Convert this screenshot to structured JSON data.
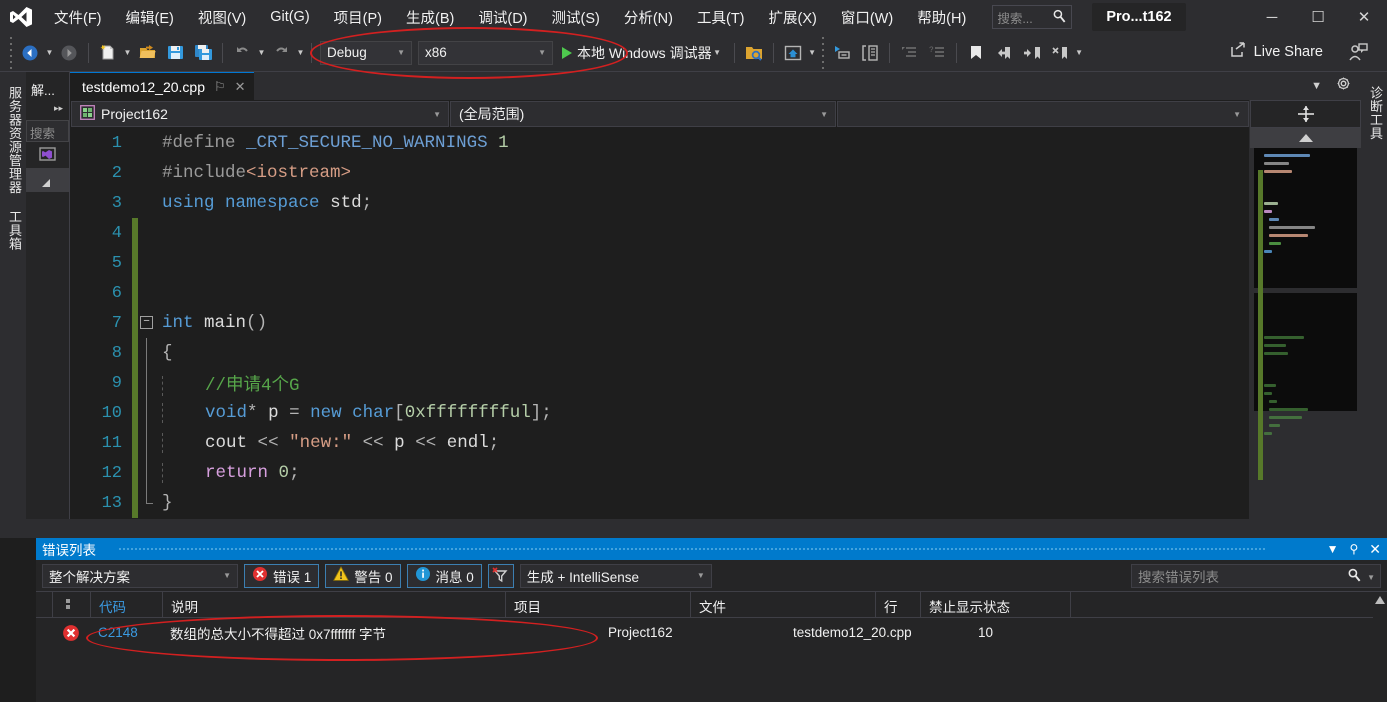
{
  "window": {
    "project_badge": "Pro...t162",
    "minimize": "─",
    "maximize": "☐",
    "close": "✕"
  },
  "menu": {
    "items": [
      {
        "label": "文件(F)",
        "name": "menu-file"
      },
      {
        "label": "编辑(E)",
        "name": "menu-edit"
      },
      {
        "label": "视图(V)",
        "name": "menu-view"
      },
      {
        "label": "Git(G)",
        "name": "menu-git"
      },
      {
        "label": "项目(P)",
        "name": "menu-project"
      },
      {
        "label": "生成(B)",
        "name": "menu-build"
      },
      {
        "label": "调试(D)",
        "name": "menu-debug"
      },
      {
        "label": "测试(S)",
        "name": "menu-test"
      },
      {
        "label": "分析(N)",
        "name": "menu-analyze"
      },
      {
        "label": "工具(T)",
        "name": "menu-tools"
      },
      {
        "label": "扩展(X)",
        "name": "menu-extensions"
      },
      {
        "label": "窗口(W)",
        "name": "menu-window"
      },
      {
        "label": "帮助(H)",
        "name": "menu-help"
      }
    ],
    "search_placeholder": "搜索..."
  },
  "toolbar": {
    "configuration": "Debug",
    "platform": "x86",
    "run_label": "本地 Windows 调试器",
    "live_share": "Live Share"
  },
  "left_dock": {
    "server_explorer": "服务器资源管理器",
    "toolbox": "工具箱"
  },
  "right_dock": {
    "diagnostic_tools": "诊断工具"
  },
  "solution_explorer": {
    "title": "解...",
    "search_placeholder": "搜索"
  },
  "editor": {
    "tab_name": "testdemo12_20.cpp",
    "pin_glyph": "⚐",
    "close_glyph": "✕",
    "nav_project": "Project162",
    "nav_scope": "(全局范围)",
    "lines": [
      {
        "n": "1",
        "changed": false,
        "fold": "none",
        "text": "#define _CRT_SECURE_NO_WARNINGS 1"
      },
      {
        "n": "2",
        "changed": false,
        "fold": "none",
        "text": "#include<iostream>"
      },
      {
        "n": "3",
        "changed": false,
        "fold": "none",
        "text": "using namespace std;"
      },
      {
        "n": "4",
        "changed": true,
        "fold": "none",
        "text": ""
      },
      {
        "n": "5",
        "changed": true,
        "fold": "none",
        "text": ""
      },
      {
        "n": "6",
        "changed": true,
        "fold": "none",
        "text": ""
      },
      {
        "n": "7",
        "changed": true,
        "fold": "minus",
        "text": "int main()"
      },
      {
        "n": "8",
        "changed": true,
        "fold": "line",
        "text": "{"
      },
      {
        "n": "9",
        "changed": true,
        "fold": "line",
        "text": "    //申请4个G"
      },
      {
        "n": "10",
        "changed": true,
        "fold": "line",
        "text": "    void* p = new char[0xfffffffful];"
      },
      {
        "n": "11",
        "changed": true,
        "fold": "line",
        "text": "    cout << \"new:\" << p << endl;"
      },
      {
        "n": "12",
        "changed": true,
        "fold": "line",
        "text": "    return 0;"
      },
      {
        "n": "13",
        "changed": true,
        "fold": "end",
        "text": "}"
      }
    ]
  },
  "error_list": {
    "title": "错误列表",
    "scope_filter": "整个解决方案",
    "errors_label": "错误 1",
    "warnings_label": "警告 0",
    "messages_label": "消息 0",
    "build_filter": "生成 + IntelliSense",
    "search_placeholder": "搜索错误列表",
    "columns": {
      "code": "代码",
      "description": "说明",
      "project": "项目",
      "file": "文件",
      "line": "行",
      "suppression": "禁止显示状态"
    },
    "rows": [
      {
        "severity": "error",
        "code": "C2148",
        "description": "数组的总大小不得超过 0x7fffffff 字节",
        "project": "Project162",
        "file": "testdemo12_20.cpp",
        "line": "10",
        "suppression": ""
      }
    ]
  },
  "colors": {
    "accent": "#007acc",
    "chrome": "#2d2d30",
    "editor_bg": "#1e1e1e",
    "annotation": "#d32020",
    "error_red": "#e03030",
    "warn_yellow": "#f2c41d",
    "changebar_green": "#57792a"
  }
}
